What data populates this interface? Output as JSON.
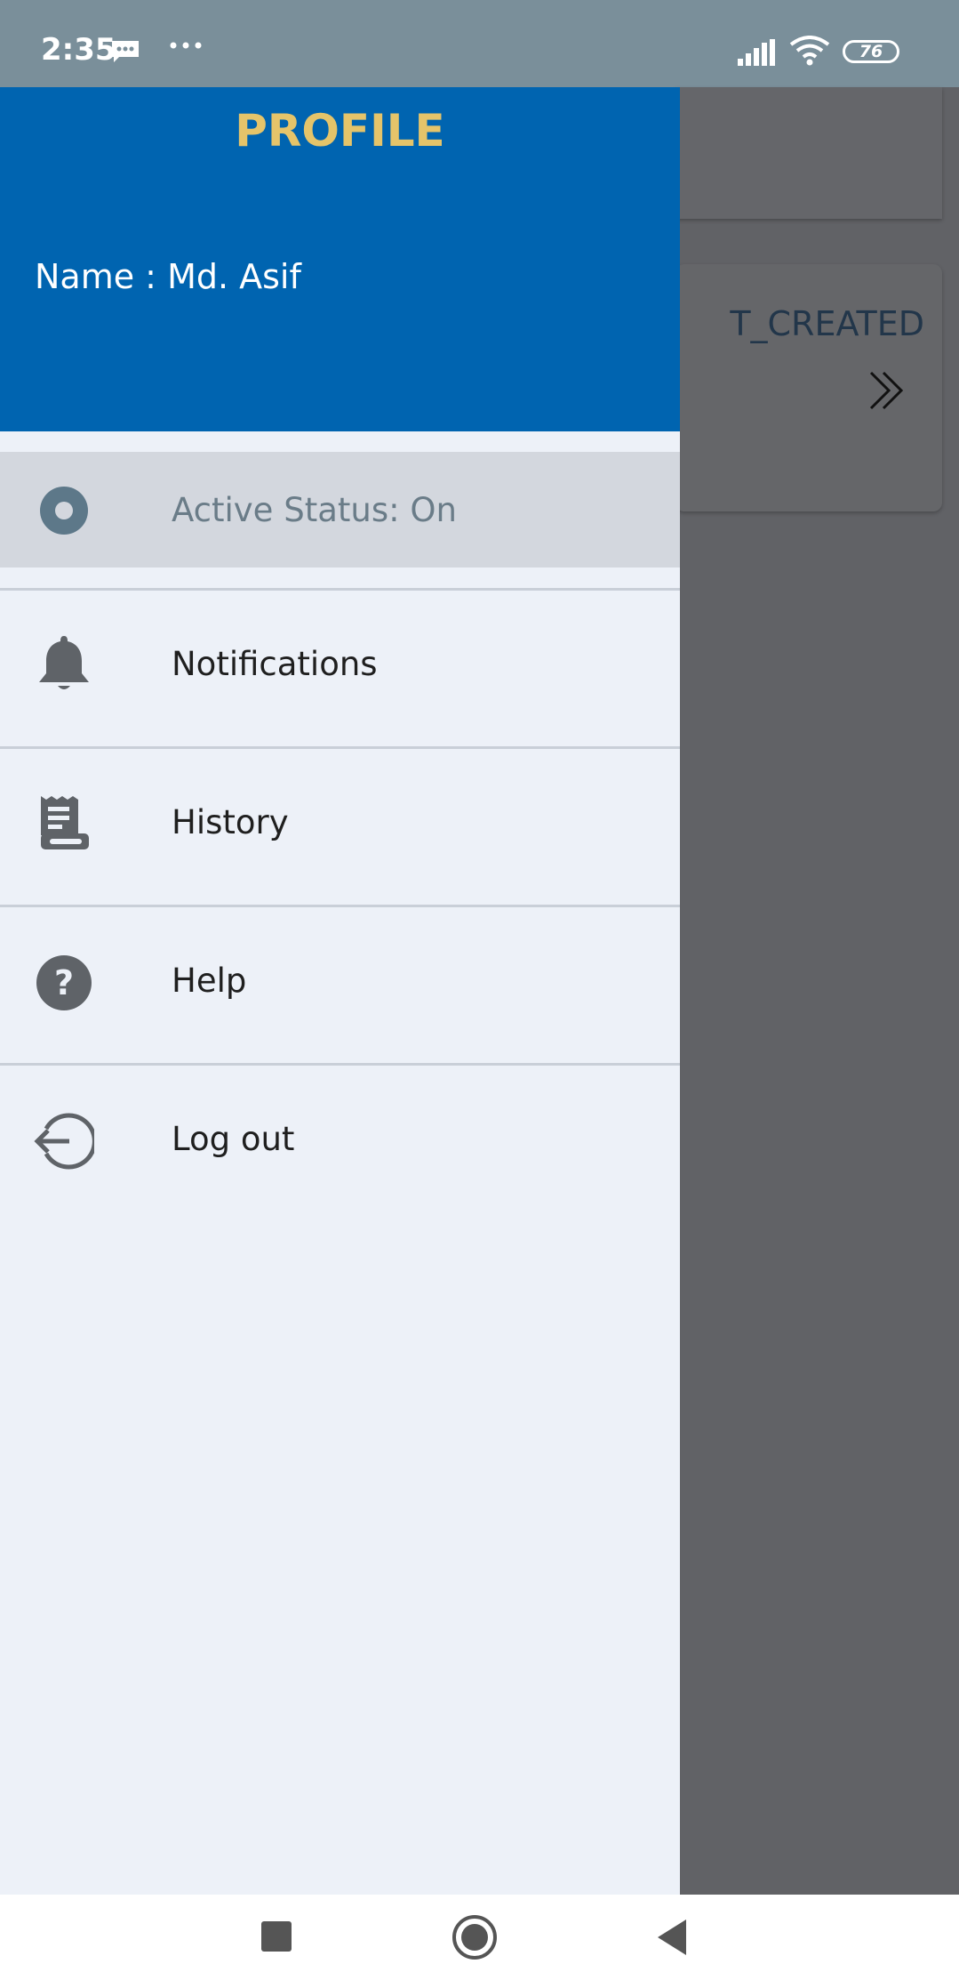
{
  "status_bar": {
    "time": "2:35",
    "battery": "76",
    "icons": [
      "message-icon",
      "more-dots-icon",
      "signal-icon",
      "wifi-icon",
      "battery-icon"
    ]
  },
  "background_app": {
    "card_text": "T_CREATED",
    "card_arrow_icon": "double-chevron-right-icon"
  },
  "drawer": {
    "title": "PROFILE",
    "name_line": "Name : Md. Asif",
    "active_status": {
      "label": "Active Status:  On",
      "icon": "radio-on-icon"
    },
    "items": [
      {
        "label": "Notifications",
        "icon": "bell-icon"
      },
      {
        "label": "History",
        "icon": "receipt-icon"
      },
      {
        "label": "Help",
        "icon": "help-circle-icon"
      },
      {
        "label": "Log out",
        "icon": "logout-icon"
      }
    ]
  },
  "colors": {
    "header_bg": "#0064b0",
    "title": "#e5c46a",
    "drawer_bg": "#edf1f8",
    "active_bg": "#d3d7de",
    "icon": "#5f6368"
  },
  "nav_bar": {
    "buttons": [
      "recents-button",
      "home-button",
      "back-button"
    ]
  }
}
